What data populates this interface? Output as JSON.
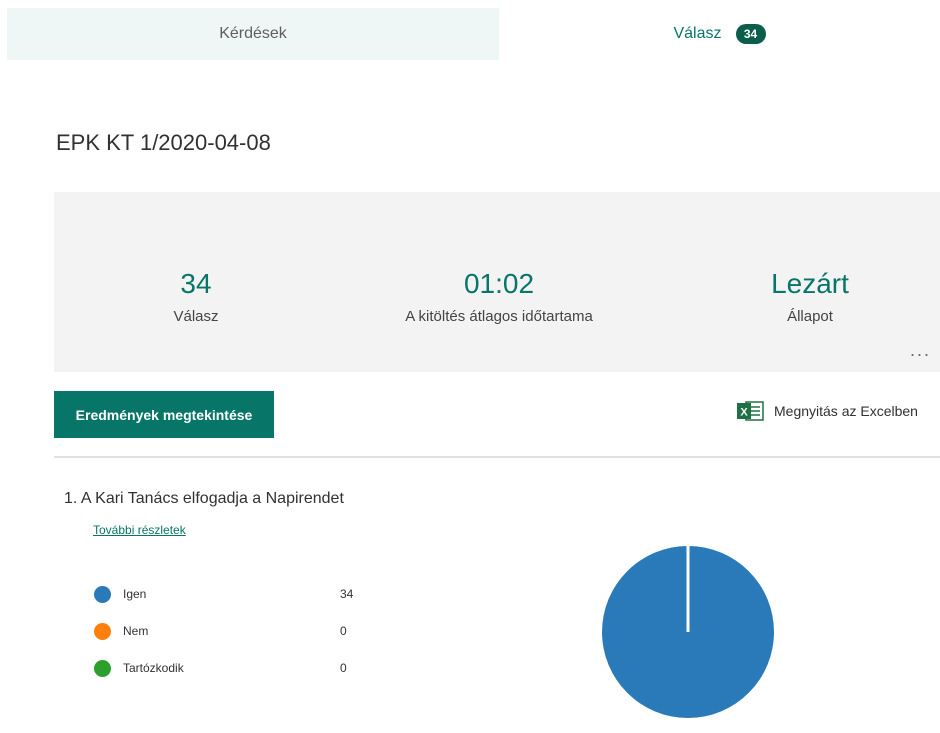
{
  "tabs": {
    "questions_label": "Kérdések",
    "responses_label": "Válasz",
    "responses_badge": "34"
  },
  "form": {
    "title": "EPK KT 1/2020-04-08"
  },
  "stats": [
    {
      "value": "34",
      "label": "Válasz"
    },
    {
      "value": "01:02",
      "label": "A kitöltés átlagos időtartama"
    },
    {
      "value": "Lezárt",
      "label": "Állapot"
    }
  ],
  "actions": {
    "more_label": "...",
    "view_results_label": "Eredmények megtekintése",
    "open_excel_label": "Megnyitás az Excelben",
    "excel_icon_text": "X"
  },
  "question": {
    "number_title": "1.  A Kari Tanács elfogadja a Napirendet",
    "details_link": "További részletek",
    "options": [
      {
        "label": "Igen",
        "count": "34",
        "color": "#2a7ab9"
      },
      {
        "label": "Nem",
        "count": "0",
        "color": "#ff7f0e"
      },
      {
        "label": "Tartózkodik",
        "count": "0",
        "color": "#2ca02c"
      }
    ]
  },
  "chart_data": {
    "type": "pie",
    "categories": [
      "Igen",
      "Nem",
      "Tartózkodik"
    ],
    "values": [
      34,
      0,
      0
    ],
    "colors": [
      "#2a7ab9",
      "#ff7f0e",
      "#2ca02c"
    ]
  },
  "colors": {
    "accent": "#077568",
    "badge": "#0b5e4b",
    "excel": "#1e7145"
  }
}
